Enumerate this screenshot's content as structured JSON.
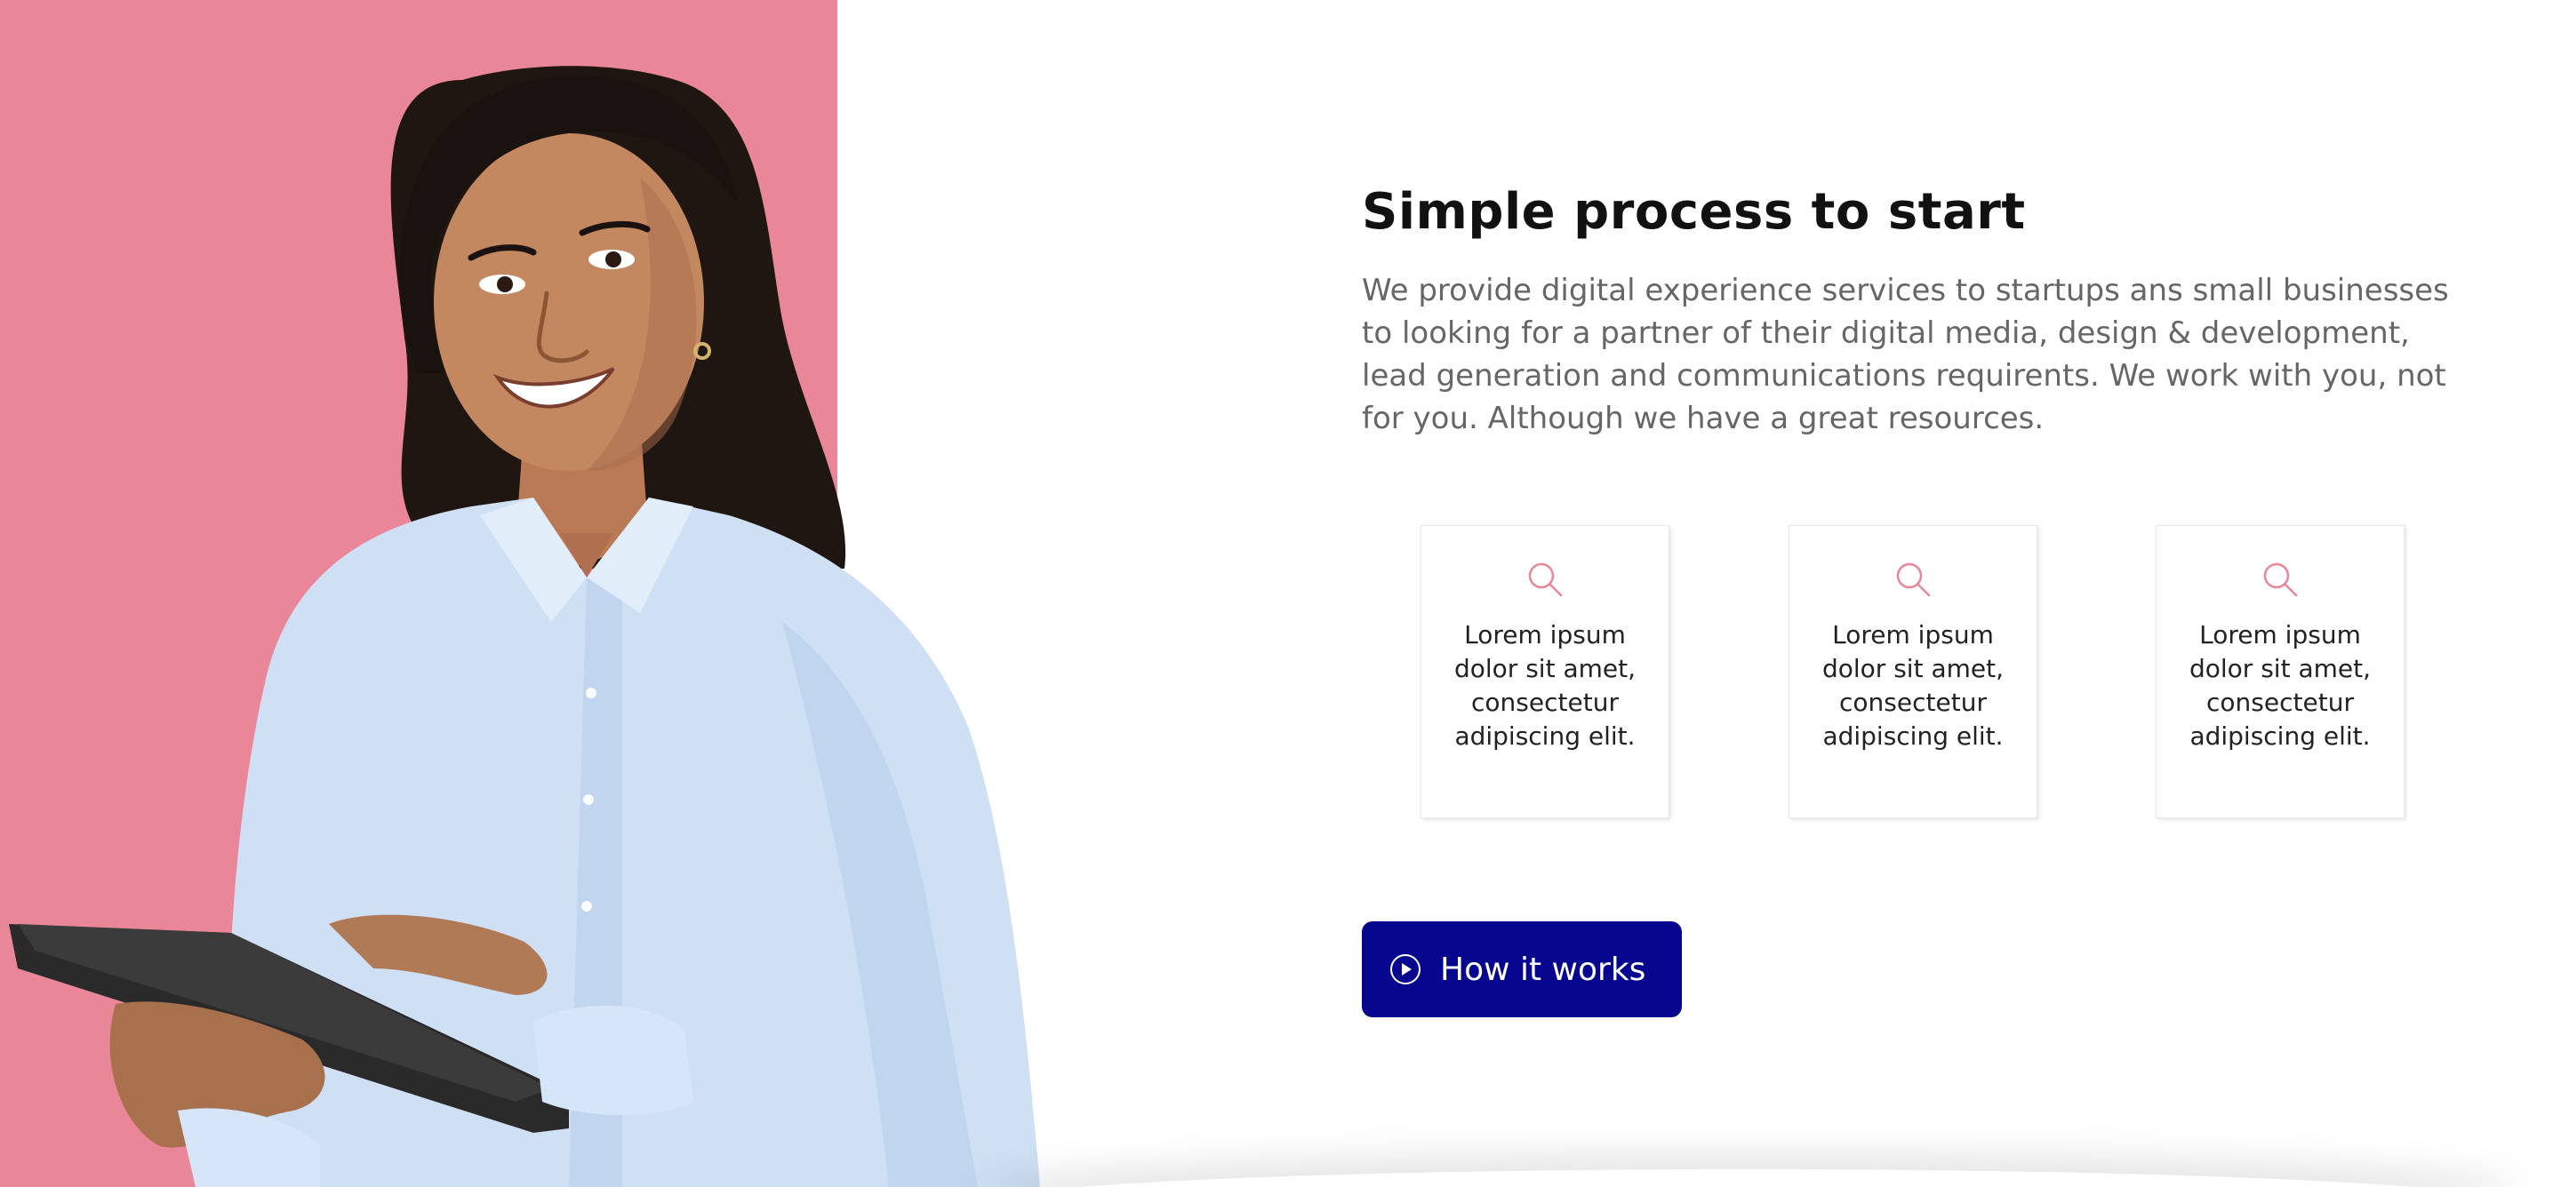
{
  "colors": {
    "accent_pink": "#e98799",
    "cta_blue": "#06068f",
    "heading": "#111111",
    "body_text": "#666666"
  },
  "hero": {
    "image_subject": "smiling woman in light blue shirt holding a tablet"
  },
  "section": {
    "title": "Simple process to start",
    "description": "We provide digital experience services to startups ans small businesses to looking for a partner of their digital media, design & development, lead generation and communications requirents. We work with you, not for you. Although we have a great resources."
  },
  "features": [
    {
      "icon": "search-icon",
      "text": "Lorem ipsum dolor sit amet, consectetur adipiscing elit."
    },
    {
      "icon": "search-icon",
      "text": "Lorem ipsum dolor sit amet, consectetur adipiscing elit."
    },
    {
      "icon": "search-icon",
      "text": "Lorem ipsum dolor sit amet, consectetur adipiscing elit."
    }
  ],
  "cta": {
    "icon": "play-circle-icon",
    "label": "How it works"
  }
}
